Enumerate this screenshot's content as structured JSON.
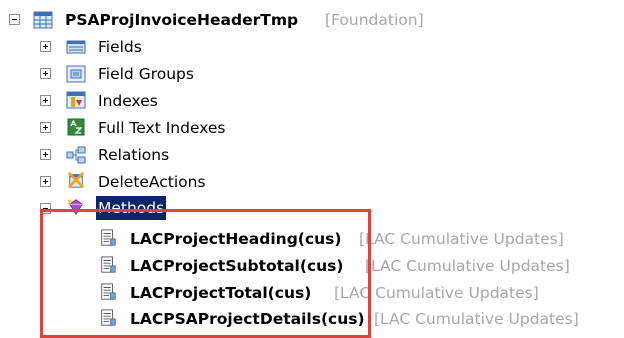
{
  "tree": {
    "root": {
      "label": "PSAProjInvoiceHeaderTmp",
      "layer": "[Foundation]"
    },
    "nodes": [
      {
        "label": "Fields",
        "icon": "fields-icon"
      },
      {
        "label": "Field Groups",
        "icon": "field-groups-icon"
      },
      {
        "label": "Indexes",
        "icon": "indexes-icon"
      },
      {
        "label": "Full Text Indexes",
        "icon": "full-text-indexes-icon"
      },
      {
        "label": "Relations",
        "icon": "relations-icon"
      },
      {
        "label": "DeleteActions",
        "icon": "delete-actions-icon"
      },
      {
        "label": "Methods",
        "icon": "methods-icon"
      }
    ],
    "methods": [
      {
        "label": "LACProjectHeading(cus)",
        "layer": "[LAC Cumulative Updates]"
      },
      {
        "label": "LACProjectSubtotal(cus)",
        "layer": "[LAC Cumulative Updates]"
      },
      {
        "label": "LACProjectTotal(cus)",
        "layer": "[LAC Cumulative Updates]"
      },
      {
        "label": "LACPSAProjectDetails(cus)",
        "layer": "[LAC Cumulative Updates]"
      }
    ]
  },
  "colors": {
    "highlight_box": "#e0423c",
    "selection_bg": "#0a246a",
    "layer_text": "#a7a7a7"
  }
}
